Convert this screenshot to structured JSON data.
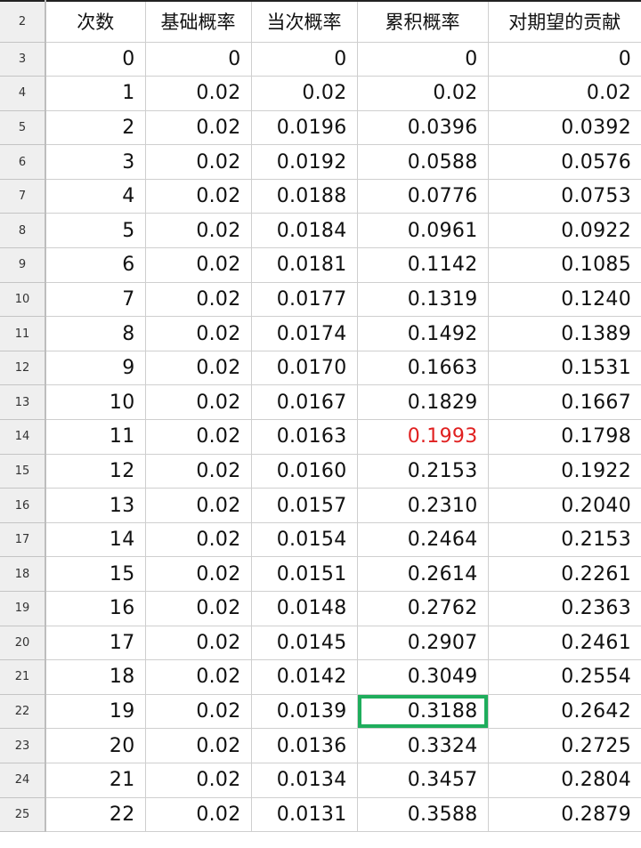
{
  "header_row": {
    "row_number": "2",
    "columns": [
      "次数",
      "基础概率",
      "当次概率",
      "累积概率",
      "对期望的贡献"
    ]
  },
  "rows": [
    {
      "row_number": "3",
      "cells": [
        "0",
        "0",
        "0",
        "0",
        "0"
      ]
    },
    {
      "row_number": "4",
      "cells": [
        "1",
        "0.02",
        "0.02",
        "0.02",
        "0.02"
      ]
    },
    {
      "row_number": "5",
      "cells": [
        "2",
        "0.02",
        "0.0196",
        "0.0396",
        "0.0392"
      ]
    },
    {
      "row_number": "6",
      "cells": [
        "3",
        "0.02",
        "0.0192",
        "0.0588",
        "0.0576"
      ]
    },
    {
      "row_number": "7",
      "cells": [
        "4",
        "0.02",
        "0.0188",
        "0.0776",
        "0.0753"
      ]
    },
    {
      "row_number": "8",
      "cells": [
        "5",
        "0.02",
        "0.0184",
        "0.0961",
        "0.0922"
      ]
    },
    {
      "row_number": "9",
      "cells": [
        "6",
        "0.02",
        "0.0181",
        "0.1142",
        "0.1085"
      ]
    },
    {
      "row_number": "10",
      "cells": [
        "7",
        "0.02",
        "0.0177",
        "0.1319",
        "0.1240"
      ]
    },
    {
      "row_number": "11",
      "cells": [
        "8",
        "0.02",
        "0.0174",
        "0.1492",
        "0.1389"
      ]
    },
    {
      "row_number": "12",
      "cells": [
        "9",
        "0.02",
        "0.0170",
        "0.1663",
        "0.1531"
      ]
    },
    {
      "row_number": "13",
      "cells": [
        "10",
        "0.02",
        "0.0167",
        "0.1829",
        "0.1667"
      ]
    },
    {
      "row_number": "14",
      "cells": [
        "11",
        "0.02",
        "0.0163",
        "0.1993",
        "0.1798"
      ]
    },
    {
      "row_number": "15",
      "cells": [
        "12",
        "0.02",
        "0.0160",
        "0.2153",
        "0.1922"
      ]
    },
    {
      "row_number": "16",
      "cells": [
        "13",
        "0.02",
        "0.0157",
        "0.2310",
        "0.2040"
      ]
    },
    {
      "row_number": "17",
      "cells": [
        "14",
        "0.02",
        "0.0154",
        "0.2464",
        "0.2153"
      ]
    },
    {
      "row_number": "18",
      "cells": [
        "15",
        "0.02",
        "0.0151",
        "0.2614",
        "0.2261"
      ]
    },
    {
      "row_number": "19",
      "cells": [
        "16",
        "0.02",
        "0.0148",
        "0.2762",
        "0.2363"
      ]
    },
    {
      "row_number": "20",
      "cells": [
        "17",
        "0.02",
        "0.0145",
        "0.2907",
        "0.2461"
      ]
    },
    {
      "row_number": "21",
      "cells": [
        "18",
        "0.02",
        "0.0142",
        "0.3049",
        "0.2554"
      ]
    },
    {
      "row_number": "22",
      "cells": [
        "19",
        "0.02",
        "0.0139",
        "0.3188",
        "0.2642"
      ]
    },
    {
      "row_number": "23",
      "cells": [
        "20",
        "0.02",
        "0.0136",
        "0.3324",
        "0.2725"
      ]
    },
    {
      "row_number": "24",
      "cells": [
        "21",
        "0.02",
        "0.0134",
        "0.3457",
        "0.2804"
      ]
    },
    {
      "row_number": "25",
      "cells": [
        "22",
        "0.02",
        "0.0131",
        "0.3588",
        "0.2879"
      ]
    }
  ],
  "highlight_color": "#e02020",
  "selection_border_color": "#1fad5c",
  "selected_cell": {
    "row_number": "22",
    "column": "累积概率"
  },
  "red_text_cell": {
    "row_number": "14",
    "column": "累积概率"
  }
}
